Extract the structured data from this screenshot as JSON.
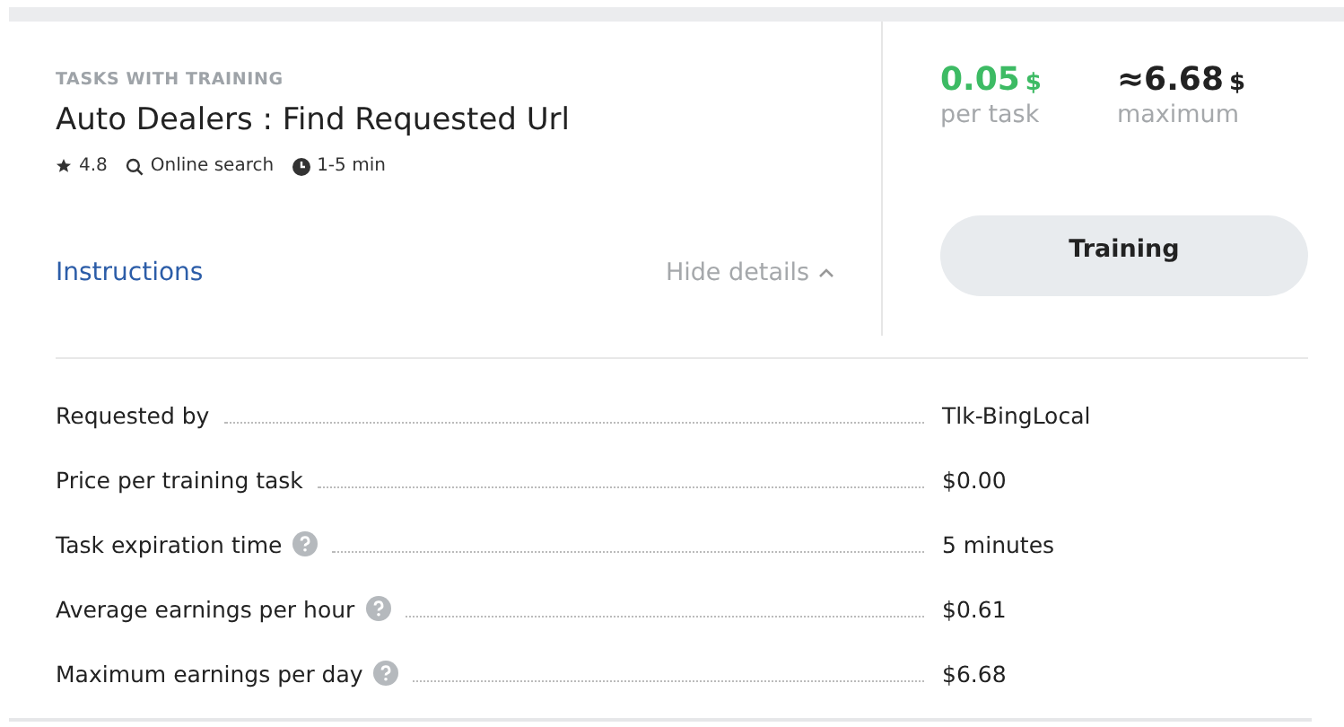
{
  "category": "TASKS WITH TRAINING",
  "title": "Auto Dealers : Find Requested Url",
  "meta": [
    {
      "kind": "rating",
      "text": "4.8"
    },
    {
      "kind": "search",
      "text": "Online search"
    },
    {
      "kind": "time",
      "text": "1-5 min"
    }
  ],
  "instructions_link": "Instructions",
  "hide_details": "Hide details",
  "price": {
    "amount": "0.05",
    "currency": "$",
    "caption": "per task"
  },
  "maximum": {
    "amount": "≈6.68",
    "currency": "$",
    "caption": "maximum"
  },
  "action_button": "Training",
  "details": [
    {
      "label": "Requested by",
      "help": false,
      "value": "Tlk-BingLocal"
    },
    {
      "label": "Price per training task",
      "help": false,
      "value": "$0.00"
    },
    {
      "label": "Task expiration time",
      "help": true,
      "value": "5 minutes"
    },
    {
      "label": "Average earnings per hour",
      "help": true,
      "value": "$0.61"
    },
    {
      "label": "Maximum earnings per day",
      "help": true,
      "value": "$6.68"
    }
  ]
}
